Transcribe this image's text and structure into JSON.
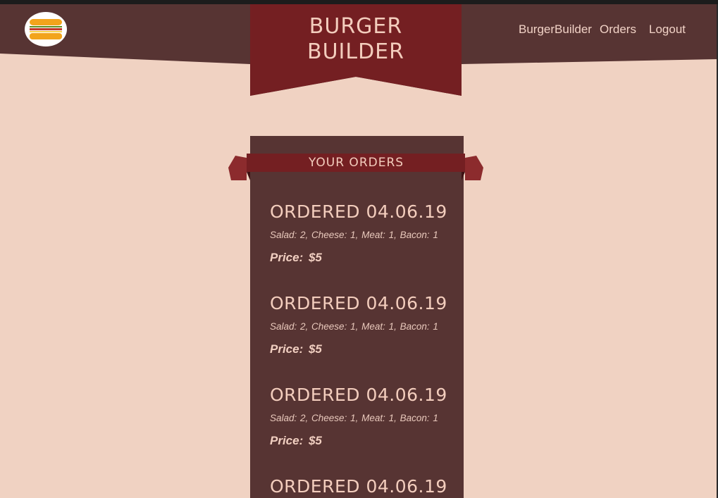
{
  "header": {
    "brand_line1": "BURGER",
    "brand_line2": "BUILDER",
    "logo_icon": "burger-icon",
    "colors": {
      "bar": "#573433",
      "banner": "#741f22",
      "background": "#f0d2c2"
    }
  },
  "nav": {
    "items": [
      {
        "label": "BurgerBuilder"
      },
      {
        "label": "Orders"
      },
      {
        "label": "Logout"
      }
    ]
  },
  "orders": {
    "heading": "YOUR ORDERS",
    "items": [
      {
        "title": "ORDERED 04.06.19",
        "ingredients": "Salad: 2, Cheese: 1, Meat: 1, Bacon: 1",
        "price": "Price: $5"
      },
      {
        "title": "ORDERED 04.06.19",
        "ingredients": "Salad: 2, Cheese: 1, Meat: 1, Bacon: 1",
        "price": "Price: $5"
      },
      {
        "title": "ORDERED 04.06.19",
        "ingredients": "Salad: 2, Cheese: 1, Meat: 1, Bacon: 1",
        "price": "Price: $5"
      },
      {
        "title": "ORDERED 04.06.19"
      }
    ]
  }
}
